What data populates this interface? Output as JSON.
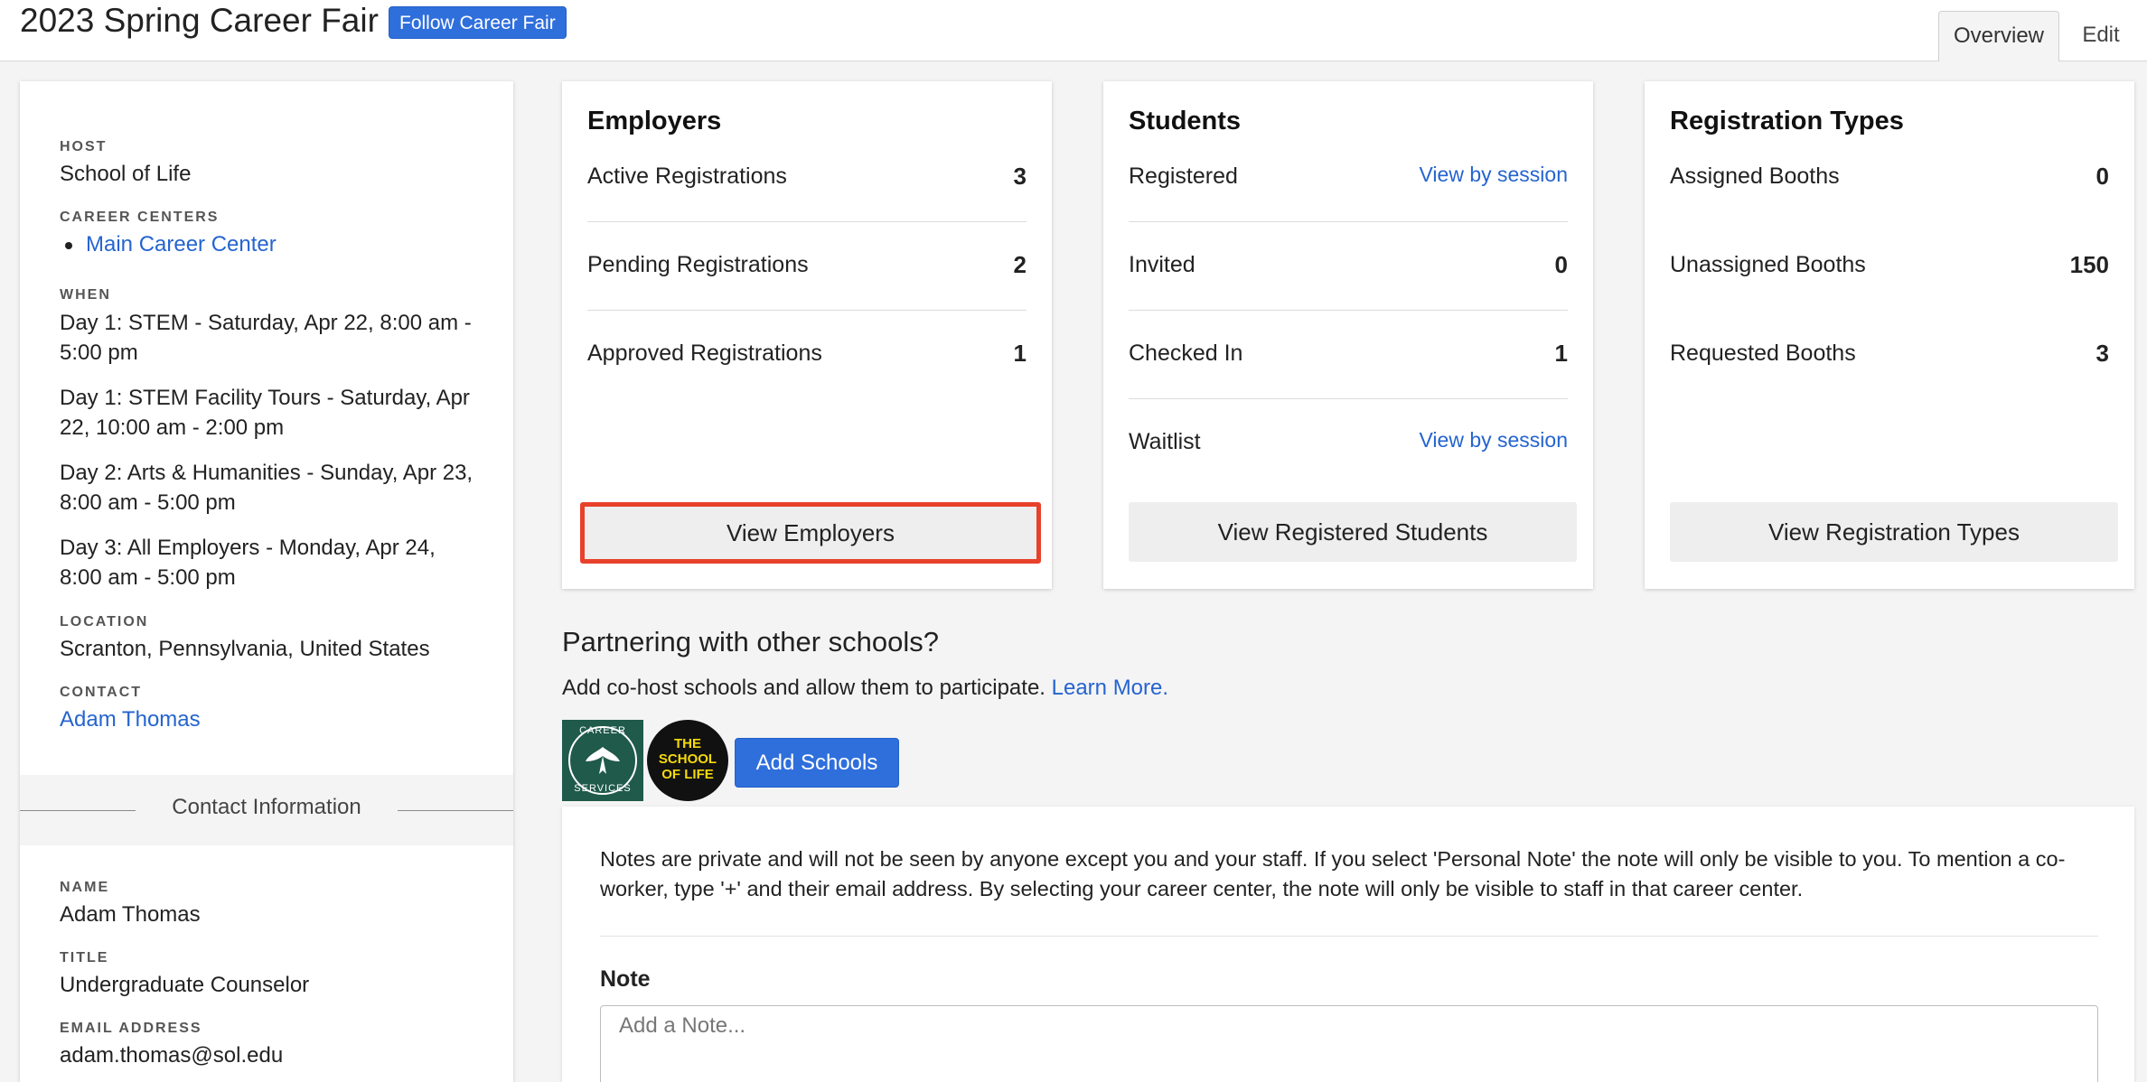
{
  "header": {
    "title": "2023 Spring Career Fair",
    "follow_label": "Follow Career Fair",
    "tabs": [
      {
        "label": "Overview",
        "active": true
      },
      {
        "label": "Edit",
        "active": false
      }
    ]
  },
  "sidebar": {
    "host_label": "HOST",
    "host": "School of Life",
    "career_centers_label": "CAREER CENTERS",
    "career_centers": [
      "Main Career Center"
    ],
    "when_label": "WHEN",
    "when": [
      {
        "line1": "Day 1: STEM - Saturday, Apr 22, 8:00 am -",
        "line2": "5:00 pm"
      },
      {
        "line1": "Day 1: STEM Facility Tours - Saturday, Apr",
        "line2": "22, 10:00 am - 2:00 pm"
      },
      {
        "line1": "Day 2: Arts & Humanities - Sunday, Apr 23,",
        "line2": "8:00 am - 5:00 pm"
      },
      {
        "line1": "Day 3: All Employers - Monday, Apr 24,",
        "line2": "8:00 am - 5:00 pm"
      }
    ],
    "location_label": "LOCATION",
    "location": "Scranton, Pennsylvania, United States",
    "contact_label": "CONTACT",
    "contact": "Adam Thomas",
    "contact_info_title": "Contact Information",
    "name_label": "NAME",
    "name": "Adam Thomas",
    "title_label": "TITLE",
    "title": "Undergraduate Counselor",
    "email_label": "EMAIL ADDRESS",
    "email": "adam.thomas@sol.edu"
  },
  "cards": {
    "employers": {
      "title": "Employers",
      "rows": [
        {
          "label": "Active Registrations",
          "value": "3"
        },
        {
          "label": "Pending Registrations",
          "value": "2"
        },
        {
          "label": "Approved Registrations",
          "value": "1"
        }
      ],
      "button": "View Employers"
    },
    "students": {
      "title": "Students",
      "rows": [
        {
          "label": "Registered",
          "link": "View by session"
        },
        {
          "label": "Invited",
          "value": "0"
        },
        {
          "label": "Checked In",
          "value": "1"
        },
        {
          "label": "Waitlist",
          "link": "View by session"
        }
      ],
      "button": "View Registered Students"
    },
    "registration_types": {
      "title": "Registration Types",
      "rows": [
        {
          "label": "Assigned Booths",
          "value": "0"
        },
        {
          "label": "Unassigned Booths",
          "value": "150"
        },
        {
          "label": "Requested Booths",
          "value": "3"
        }
      ],
      "button": "View Registration Types"
    }
  },
  "partnering": {
    "title": "Partnering with other schools?",
    "description": "Add co-host schools and allow them to participate.",
    "learn_more": "Learn More.",
    "add_schools": "Add Schools",
    "career_logo": {
      "top": "CAREER",
      "bottom": "SERVICES"
    },
    "sol_logo": {
      "line1": "THE",
      "line2": "SCHOOL",
      "line3": "OF LIFE"
    }
  },
  "notes": {
    "info": "Notes are private and will not be seen by anyone except you and your staff. If you select 'Personal Note' the note will only be visible to you. To mention a co-worker, type '+' and their email address. By selecting your career center, the note will only be visible to staff in that career center.",
    "label": "Note",
    "placeholder": "Add a Note..."
  },
  "colors": {
    "primary": "#2f6fdc",
    "link": "#2564d0",
    "highlight": "#e8412b",
    "career_logo_bg": "#1f5a4a",
    "sol_logo_text": "#f5d90a"
  }
}
